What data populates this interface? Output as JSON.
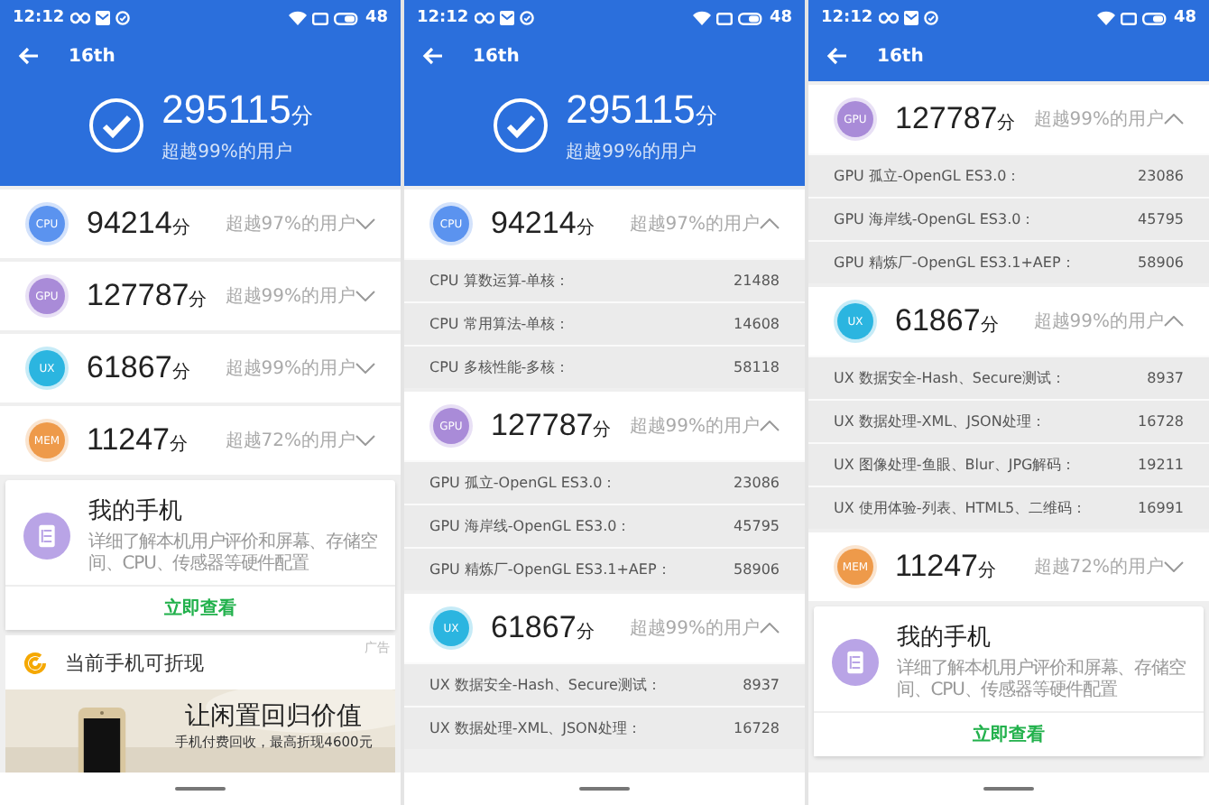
{
  "screens": [
    {
      "status_bar": {
        "time": "12:12",
        "battery": "48"
      },
      "title": "16th",
      "total": {
        "score": "295115",
        "unit": "分",
        "percentile": "超越99%的用户"
      },
      "items": [
        {
          "kind": "category",
          "badge": "CPU",
          "color": "#5b93ef",
          "score": "94214",
          "unit": "分",
          "percentile": "超越97%的用户",
          "expanded": false
        },
        {
          "kind": "category",
          "badge": "GPU",
          "color": "#a98bd8",
          "score": "127787",
          "unit": "分",
          "percentile": "超越99%的用户",
          "expanded": false
        },
        {
          "kind": "category",
          "badge": "UX",
          "color": "#2bb5e0",
          "score": "61867",
          "unit": "分",
          "percentile": "超越99%的用户",
          "expanded": false
        },
        {
          "kind": "category",
          "badge": "MEM",
          "color": "#ee9a4a",
          "score": "11247",
          "unit": "分",
          "percentile": "超越72%的用户",
          "expanded": false
        },
        {
          "kind": "card",
          "title": "我的手机",
          "description": "详细了解本机用户评价和屏幕、存储空间、CPU、传感器等硬件配置",
          "button": "立即查看"
        },
        {
          "kind": "ad",
          "title": "当前手机可折现",
          "tag": "广告",
          "headline": "让闲置回归价值",
          "subline": "手机付费回收，最高折现4600元"
        }
      ]
    },
    {
      "status_bar": {
        "time": "12:12",
        "battery": "48"
      },
      "title": "16th",
      "total": {
        "score": "295115",
        "unit": "分",
        "percentile": "超越99%的用户"
      },
      "items": [
        {
          "kind": "category",
          "badge": "CPU",
          "color": "#5b93ef",
          "score": "94214",
          "unit": "分",
          "percentile": "超越97%的用户",
          "expanded": true
        },
        {
          "kind": "subscore",
          "label": "CPU 算数运算-单核：",
          "value": "21488"
        },
        {
          "kind": "subscore",
          "label": "CPU 常用算法-单核：",
          "value": "14608"
        },
        {
          "kind": "subscore",
          "label": "CPU 多核性能-多核：",
          "value": "58118"
        },
        {
          "kind": "category",
          "badge": "GPU",
          "color": "#a98bd8",
          "score": "127787",
          "unit": "分",
          "percentile": "超越99%的用户",
          "expanded": true
        },
        {
          "kind": "subscore",
          "label": "GPU 孤立-OpenGL ES3.0：",
          "value": "23086"
        },
        {
          "kind": "subscore",
          "label": "GPU 海岸线-OpenGL ES3.0：",
          "value": "45795"
        },
        {
          "kind": "subscore",
          "label": "GPU 精炼厂-OpenGL ES3.1+AEP：",
          "value": "58906"
        },
        {
          "kind": "category",
          "badge": "UX",
          "color": "#2bb5e0",
          "score": "61867",
          "unit": "分",
          "percentile": "超越99%的用户",
          "expanded": true
        },
        {
          "kind": "subscore",
          "label": "UX 数据安全-Hash、Secure测试：",
          "value": "8937"
        },
        {
          "kind": "subscore",
          "label": "UX 数据处理-XML、JSON处理：",
          "value": "16728"
        }
      ]
    },
    {
      "status_bar": {
        "time": "12:12",
        "battery": "48"
      },
      "title": "16th",
      "items": [
        {
          "kind": "category",
          "badge": "GPU",
          "color": "#a98bd8",
          "score": "127787",
          "unit": "分",
          "percentile": "超越99%的用户",
          "expanded": true
        },
        {
          "kind": "subscore",
          "label": "GPU 孤立-OpenGL ES3.0：",
          "value": "23086"
        },
        {
          "kind": "subscore",
          "label": "GPU 海岸线-OpenGL ES3.0：",
          "value": "45795"
        },
        {
          "kind": "subscore",
          "label": "GPU 精炼厂-OpenGL ES3.1+AEP：",
          "value": "58906"
        },
        {
          "kind": "category",
          "badge": "UX",
          "color": "#2bb5e0",
          "score": "61867",
          "unit": "分",
          "percentile": "超越99%的用户",
          "expanded": true
        },
        {
          "kind": "subscore",
          "label": "UX 数据安全-Hash、Secure测试：",
          "value": "8937"
        },
        {
          "kind": "subscore",
          "label": "UX 数据处理-XML、JSON处理：",
          "value": "16728"
        },
        {
          "kind": "subscore",
          "label": "UX 图像处理-鱼眼、Blur、JPG解码：",
          "value": "19211"
        },
        {
          "kind": "subscore",
          "label": "UX 使用体验-列表、HTML5、二维码：",
          "value": "16991"
        },
        {
          "kind": "category",
          "badge": "MEM",
          "color": "#ee9a4a",
          "score": "11247",
          "unit": "分",
          "percentile": "超越72%的用户",
          "expanded": false
        },
        {
          "kind": "card",
          "title": "我的手机",
          "description": "详细了解本机用户评价和屏幕、存储空间、CPU、传感器等硬件配置",
          "button": "立即查看"
        }
      ]
    }
  ]
}
